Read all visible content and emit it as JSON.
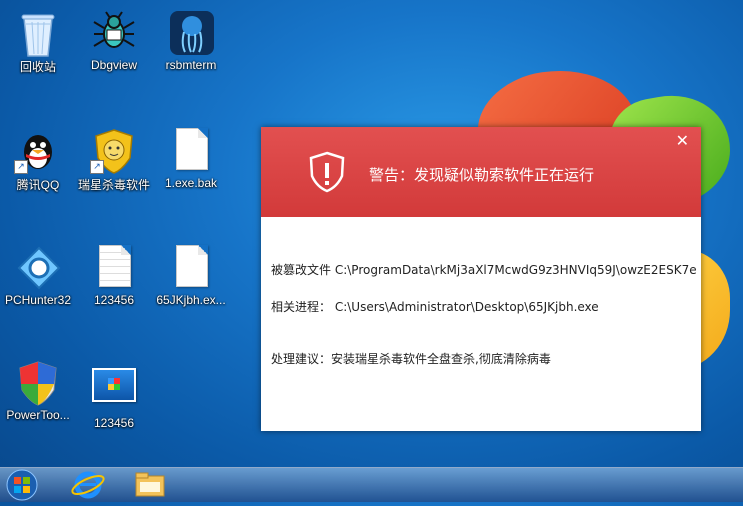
{
  "desktop": {
    "icons": [
      {
        "label": "回收站"
      },
      {
        "label": "Dbgview"
      },
      {
        "label": "rsbmterm"
      },
      {
        "label": "腾讯QQ"
      },
      {
        "label": "瑞星杀毒软件"
      },
      {
        "label": "1.exe.bak"
      },
      {
        "label": "PCHunter32"
      },
      {
        "label": "123456"
      },
      {
        "label": "65JKjbh.ex..."
      },
      {
        "label": "PowerToo..."
      },
      {
        "label": "123456"
      }
    ]
  },
  "dialog": {
    "title": "警告：发现疑似勒索软件正在运行",
    "close_glyph": "✕",
    "modified_label": "被篡改文件",
    "modified_value": "C:\\ProgramData\\rkMj3aXl7McwdG9z3HNVIq59J\\owzE2ESK7e",
    "process_label": "相关进程：",
    "process_value": "C:\\Users\\Administrator\\Desktop\\65JKjbh.exe",
    "advice": "处理建议：安装瑞星杀毒软件全盘查杀,彻底清除病毒"
  },
  "taskbar": {
    "items": [
      "start-orb",
      "internet-explorer-icon",
      "windows-explorer-icon"
    ]
  }
}
